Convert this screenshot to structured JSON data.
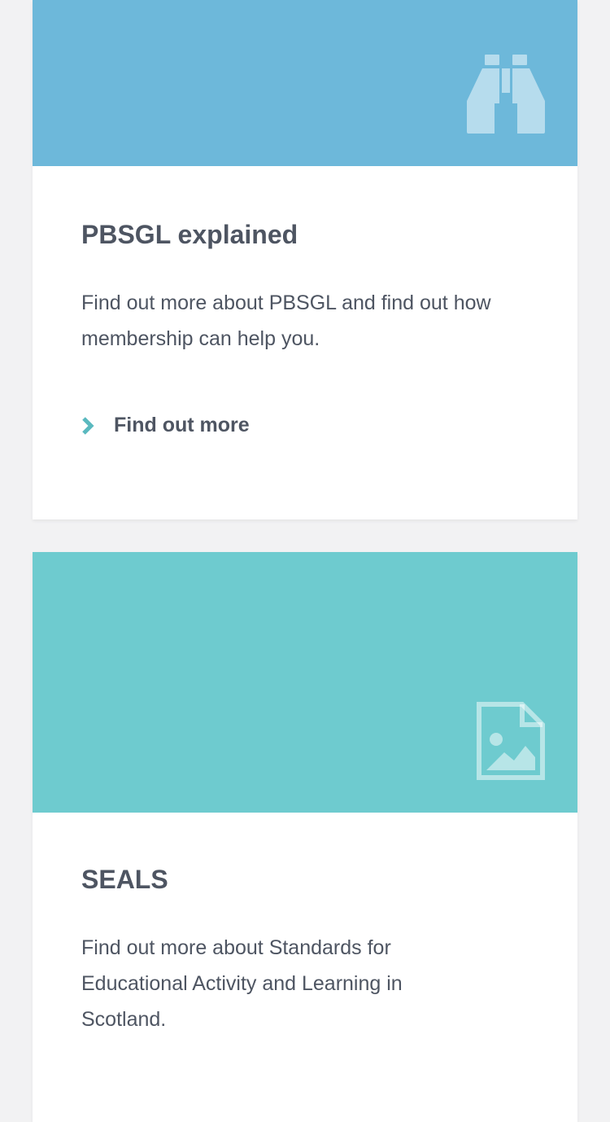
{
  "cards": [
    {
      "banner_color": "#6db8da",
      "icon": "binoculars-icon",
      "title": "PBSGL explained",
      "description": "Find out more about PBSGL and find out how membership can help you.",
      "link_label": "Find out more",
      "link_icon": "chevron-right-icon"
    },
    {
      "banner_color": "#6ecbcf",
      "icon": "image-file-icon",
      "title": "SEALS",
      "description": "Find out more about Standards for Educational Activity and Learning in Scotland."
    }
  ],
  "colors": {
    "page_background": "#f2f2f3",
    "text": "#4e5562",
    "accent_chevron": "#5ab9bf"
  }
}
